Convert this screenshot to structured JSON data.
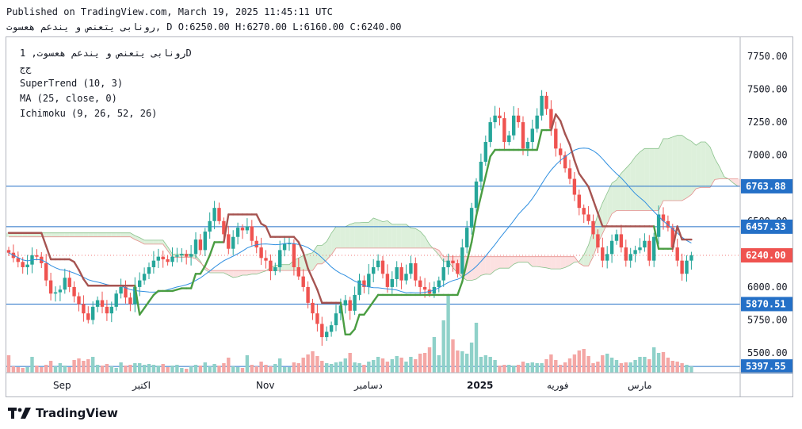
{
  "header": {
    "published": "Published on TradingView.com, March 19, 2025 11:45:11 UTC",
    "ohlc_line": "رونابی یتعنص و یندعم هعسوت, D O:6250.00 H:6270.00 L:6160.00 C:6240.00"
  },
  "legend": {
    "symbol_line": "رونابی یتعنص و یندعم هعسوت, 1D",
    "exchange": "ج‌ج",
    "supertrend": "SuperTrend (10, 3)",
    "ma": "MA (25, close, 0)",
    "ichimoku": "Ichimoku (9, 26, 52, 26)"
  },
  "brand": {
    "name": "TradingView",
    "icon": "tradingview-logo-icon"
  },
  "colors": {
    "up": "#26a69a",
    "down": "#ef5350",
    "up_vol": "#8fd1c9",
    "down_vol": "#f4a7a5",
    "supertrend_up": "#4a9d42",
    "supertrend_down": "#a65451",
    "ma": "#2f8fe0",
    "level": "#2470c7",
    "cloud_bear": "#fbd9d9",
    "cloud_bull": "#d5ecd2"
  },
  "chart_data": {
    "type": "candlestick",
    "ylim": [
      5350,
      7900
    ],
    "y_ticks": [
      "7750.00",
      "7500.00",
      "7250.00",
      "7000.00",
      "6750.00",
      "6500.00",
      "6250.00",
      "6000.00",
      "5750.00",
      "5500.00"
    ],
    "x_labels": [
      "Sep",
      "اکتبر",
      "Nov",
      "دسامبر",
      "2025",
      "فوریه",
      "مارس"
    ],
    "price_levels": [
      {
        "value": 6763.88,
        "label": "6763.88"
      },
      {
        "value": 6457.33,
        "label": "6457.33"
      },
      {
        "value": 5870.51,
        "label": "5870.51"
      },
      {
        "value": 5397.55,
        "label": "5397.55"
      }
    ],
    "last_price": {
      "value": 6240.0,
      "label": "6240.00"
    },
    "bars_total": 147,
    "closes": [
      6260,
      6220,
      6190,
      6150,
      6170,
      6240,
      6230,
      6180,
      6050,
      5950,
      5960,
      5980,
      6070,
      6000,
      5930,
      5870,
      5800,
      5750,
      5850,
      5900,
      5850,
      5800,
      5850,
      5950,
      6000,
      5920,
      5870,
      6000,
      6050,
      6100,
      6150,
      6200,
      6230,
      6210,
      6190,
      6230,
      6240,
      6250,
      6230,
      6250,
      6360,
      6280,
      6420,
      6500,
      6600,
      6500,
      6400,
      6290,
      6380,
      6450,
      6430,
      6460,
      6350,
      6300,
      6220,
      6200,
      6120,
      6150,
      6280,
      6330,
      6330,
      6150,
      6080,
      6000,
      5880,
      5800,
      5720,
      5620,
      5660,
      5710,
      5800,
      5860,
      5900,
      5820,
      5940,
      6050,
      6000,
      6100,
      6150,
      6200,
      6100,
      6000,
      6060,
      6150,
      6050,
      6100,
      6180,
      6050,
      6000,
      5980,
      5950,
      6000,
      6050,
      6150,
      6200,
      6180,
      6100,
      6300,
      6450,
      6600,
      6800,
      6950,
      7100,
      7250,
      7300,
      7280,
      7100,
      7150,
      7300,
      7250,
      7050,
      7100,
      7200,
      7300,
      7450,
      7350,
      7200,
      7050,
      7000,
      6900,
      6820,
      6700,
      6600,
      6550,
      6500,
      6400,
      6300,
      6200,
      6250,
      6350,
      6400,
      6300,
      6200,
      6250,
      6280,
      6300,
      6350,
      6200,
      6380,
      6550,
      6500,
      6450,
      6300,
      6200,
      6100,
      6200,
      6240
    ],
    "volumes": [
      0.22,
      0.08,
      0.07,
      0.06,
      0.07,
      0.2,
      0.09,
      0.07,
      0.1,
      0.15,
      0.08,
      0.12,
      0.09,
      0.07,
      0.16,
      0.18,
      0.15,
      0.17,
      0.2,
      0.1,
      0.09,
      0.11,
      0.08,
      0.06,
      0.13,
      0.09,
      0.1,
      0.12,
      0.12,
      0.1,
      0.11,
      0.1,
      0.09,
      0.11,
      0.07,
      0.09,
      0.1,
      0.06,
      0.05,
      0.08,
      0.1,
      0.09,
      0.13,
      0.08,
      0.11,
      0.09,
      0.12,
      0.19,
      0.08,
      0.07,
      0.06,
      0.22,
      0.1,
      0.08,
      0.14,
      0.1,
      0.08,
      0.11,
      0.18,
      0.07,
      0.07,
      0.13,
      0.12,
      0.19,
      0.23,
      0.27,
      0.21,
      0.15,
      0.12,
      0.11,
      0.13,
      0.14,
      0.18,
      0.25,
      0.13,
      0.12,
      0.1,
      0.14,
      0.16,
      0.2,
      0.18,
      0.14,
      0.17,
      0.21,
      0.19,
      0.14,
      0.2,
      0.17,
      0.24,
      0.25,
      0.32,
      0.45,
      0.22,
      0.66,
      0.98,
      0.42,
      0.28,
      0.27,
      0.24,
      0.38,
      0.63,
      0.2,
      0.22,
      0.2,
      0.16,
      0.09,
      0.1,
      0.1,
      0.09,
      0.1,
      0.14,
      0.12,
      0.13,
      0.12,
      0.12,
      0.17,
      0.23,
      0.16,
      0.1,
      0.13,
      0.18,
      0.23,
      0.28,
      0.3,
      0.21,
      0.12,
      0.14,
      0.22,
      0.24,
      0.19,
      0.16,
      0.12,
      0.13,
      0.13,
      0.16,
      0.2,
      0.2,
      0.17,
      0.32,
      0.25,
      0.26,
      0.19,
      0.15,
      0.14,
      0.12,
      0.1,
      0.08
    ]
  }
}
